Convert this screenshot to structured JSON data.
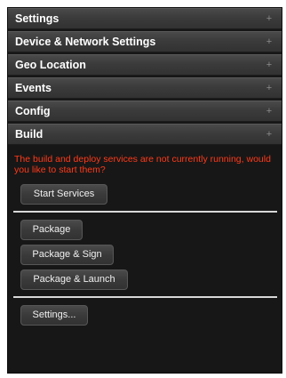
{
  "accordion": {
    "sections": [
      {
        "label": "Settings"
      },
      {
        "label": "Device & Network Settings"
      },
      {
        "label": "Geo Location"
      },
      {
        "label": "Events"
      },
      {
        "label": "Config"
      },
      {
        "label": "Build"
      }
    ],
    "expand_glyph": "+"
  },
  "build": {
    "notice": "The build and deploy services are not currently running, would you like to start them?",
    "start_services_label": "Start Services",
    "package_label": "Package",
    "package_sign_label": "Package & Sign",
    "package_launch_label": "Package & Launch",
    "settings_label": "Settings..."
  },
  "colors": {
    "notice": "#ff3a1a",
    "panel_bg": "#171717",
    "header_bg": "#3b3b3b",
    "divider": "#d8d8d8"
  }
}
